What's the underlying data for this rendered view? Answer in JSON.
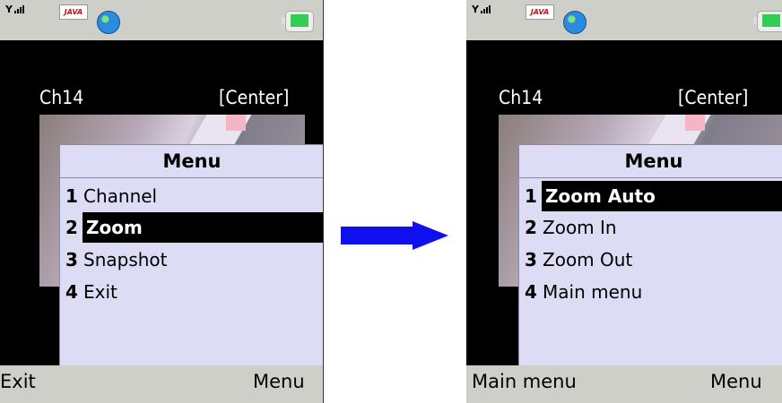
{
  "left_screen": {
    "java_badge": "JAVA",
    "channel": "Ch14",
    "view": "[Center]",
    "menu": {
      "title": "Menu",
      "items": [
        {
          "num": "1",
          "label": "Channel",
          "selected": false
        },
        {
          "num": "2",
          "label": "Zoom",
          "selected": true
        },
        {
          "num": "3",
          "label": "Snapshot",
          "selected": false
        },
        {
          "num": "4",
          "label": "Exit",
          "selected": false
        }
      ]
    },
    "softkeys": {
      "left": "Exit",
      "right": "Menu"
    }
  },
  "right_screen": {
    "java_badge": "JAVA",
    "channel": "Ch14",
    "view": "[Center]",
    "menu": {
      "title": "Menu",
      "items": [
        {
          "num": "1",
          "label": "Zoom Auto",
          "selected": true
        },
        {
          "num": "2",
          "label": "Zoom In",
          "selected": false
        },
        {
          "num": "3",
          "label": "Zoom Out",
          "selected": false
        },
        {
          "num": "4",
          "label": "Main menu",
          "selected": false
        }
      ]
    },
    "softkeys": {
      "left": "Main menu",
      "right": "Menu"
    }
  },
  "icons": [
    "signal-icon",
    "java-icon",
    "globe-icon",
    "battery-icon",
    "right-arrow-icon"
  ],
  "colors": {
    "menu_bg": "#dcdcf5",
    "status_bg": "#cfcfc9",
    "selection": "#000000",
    "arrow": "#1010ee"
  }
}
